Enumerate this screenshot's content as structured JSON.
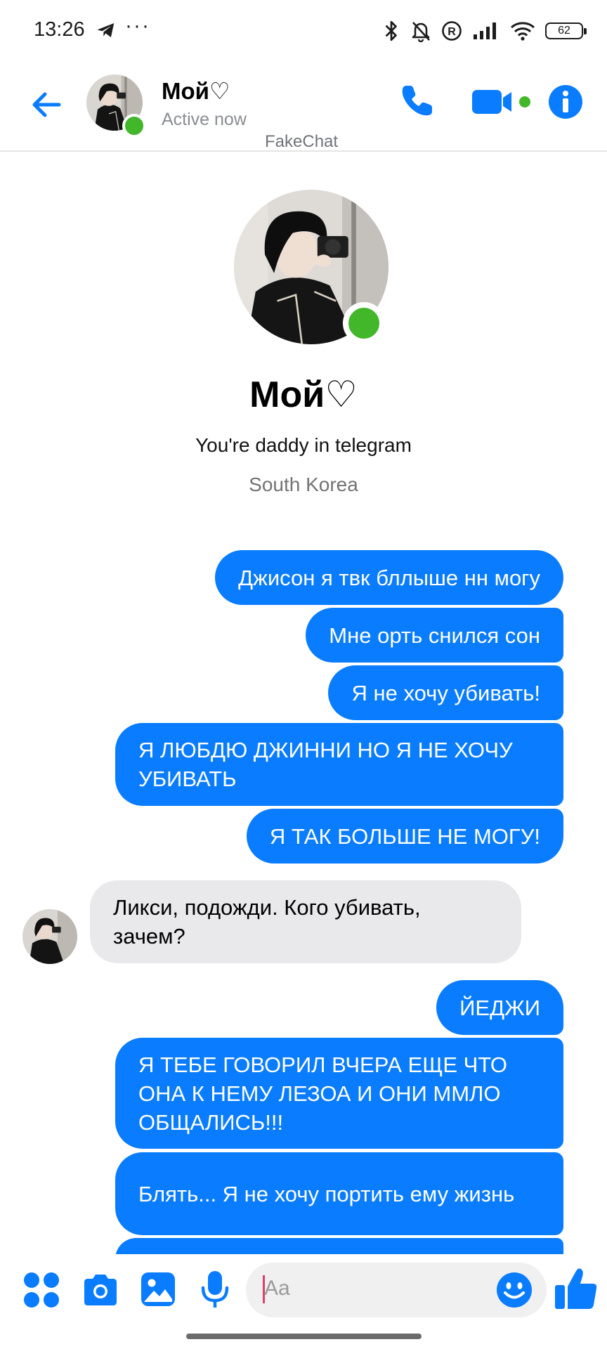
{
  "status_bar": {
    "time": "13:26",
    "more": "···",
    "battery": "62"
  },
  "header": {
    "contact_name": "Мой♡",
    "status": "Active now",
    "watermark": "FakeChat"
  },
  "profile": {
    "name": "Мой♡",
    "bio": "You're daddy in telegram",
    "location": "South Korea"
  },
  "messages": [
    {
      "from": "me",
      "text": "Джисон я твк бллыше нн могу"
    },
    {
      "from": "me",
      "text": "Мне орть снился сон"
    },
    {
      "from": "me",
      "text": "Я не хочу убивать!"
    },
    {
      "from": "me",
      "text": "Я ЛЮБДЮ ДЖИННИ НО Я НЕ ХОЧУ УБИВАТЬ"
    },
    {
      "from": "me",
      "text": "Я ТАК БОЛЬШЕ НЕ МОГУ!"
    },
    {
      "from": "contact",
      "text": "Ликси, подожди. Кого убивать, зачем?"
    },
    {
      "from": "me",
      "text": "ЙЕДЖИ"
    },
    {
      "from": "me",
      "text": "Я ТЕБЕ ГОВОРИЛ ВЧЕРА ЕЩЕ ЧТО ОНА К НЕМУ ЛЕЗОА И ОНИ ММЛО ОБЩАЛИСЬ!!!"
    },
    {
      "from": "me",
      "text": "Блять... Я не хочу портить ему жизнь"
    }
  ],
  "composer": {
    "placeholder": "Aa"
  },
  "colors": {
    "accent": "#0a7cff",
    "online": "#42b72a",
    "incoming_bubble": "#e9e9eb"
  },
  "icons": [
    "telegram-icon",
    "bluetooth-icon",
    "bell-off-icon",
    "registered-icon",
    "signal-icon",
    "wifi-icon",
    "battery-icon",
    "back-arrow-icon",
    "phone-icon",
    "video-icon",
    "info-icon",
    "apps-grid-icon",
    "camera-icon",
    "image-icon",
    "microphone-icon",
    "emoji-icon",
    "thumbs-up-icon"
  ]
}
